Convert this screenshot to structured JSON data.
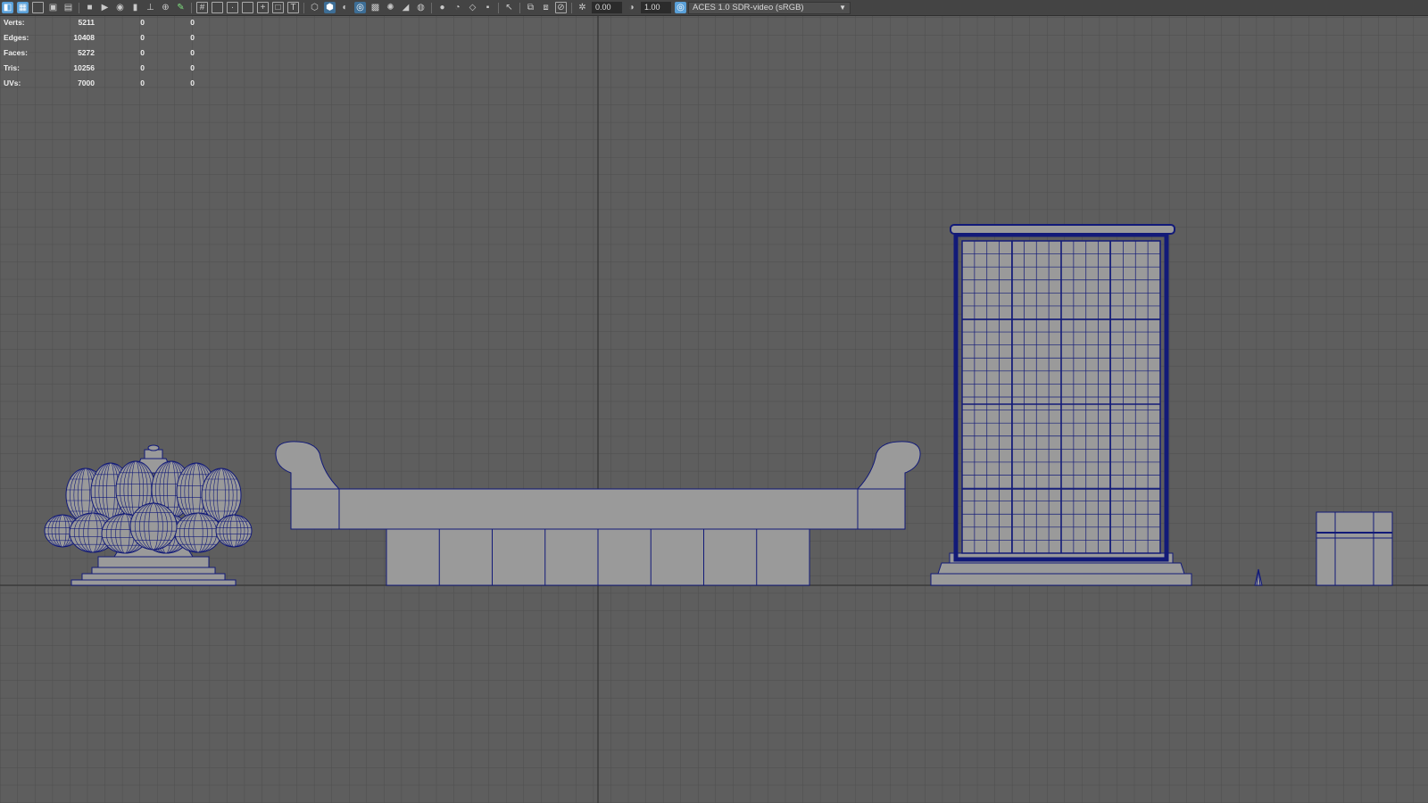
{
  "toolbar": {
    "exposure_value": "0.00",
    "gamma_value": "1.00",
    "color_space": "ACES 1.0 SDR-video (sRGB)",
    "icons": [
      "select-camera-icon",
      "camera-attributes-icon",
      "bookmark-icon",
      "image-plane-icon",
      "grid-icon",
      "film-gate-icon",
      "resolution-gate-icon",
      "gate-mask-icon",
      "field-chart-icon",
      "safe-action-icon",
      "safe-title-icon",
      "wireframe-icon",
      "smooth-shade-icon",
      "default-material-icon",
      "textured-icon",
      "use-all-lights-icon",
      "shadows-icon",
      "screen-space-ao-icon",
      "motion-blur-icon",
      "anti-aliasing-icon",
      "isolate-select-icon",
      "xray-icon",
      "xray-joints-icon",
      "xray-components-icon",
      "exposure-icon",
      "gamma-icon",
      "color-management-icon"
    ]
  },
  "hud": {
    "rows": [
      {
        "label": "Verts:",
        "object": "5211",
        "selected": "0",
        "highlighted": "0"
      },
      {
        "label": "Edges:",
        "object": "10408",
        "selected": "0",
        "highlighted": "0"
      },
      {
        "label": "Faces:",
        "object": "5272",
        "selected": "0",
        "highlighted": "0"
      },
      {
        "label": "Tris:",
        "object": "10256",
        "selected": "0",
        "highlighted": "0"
      },
      {
        "label": "UVs:",
        "object": "7000",
        "selected": "0",
        "highlighted": "0"
      }
    ]
  },
  "colors": {
    "background": "#5e5e5e",
    "grid_line": "#4e4e4e",
    "axis_line": "#3a3a3a",
    "mesh_fill": "#9a9a9a",
    "wireframe": "#121a78"
  },
  "scene": {
    "view": "front orthographic",
    "objects": [
      "lotus-censer-mesh",
      "altar-table-mesh",
      "window-screen-mesh",
      "small-cone-mesh",
      "small-box-mesh"
    ]
  }
}
